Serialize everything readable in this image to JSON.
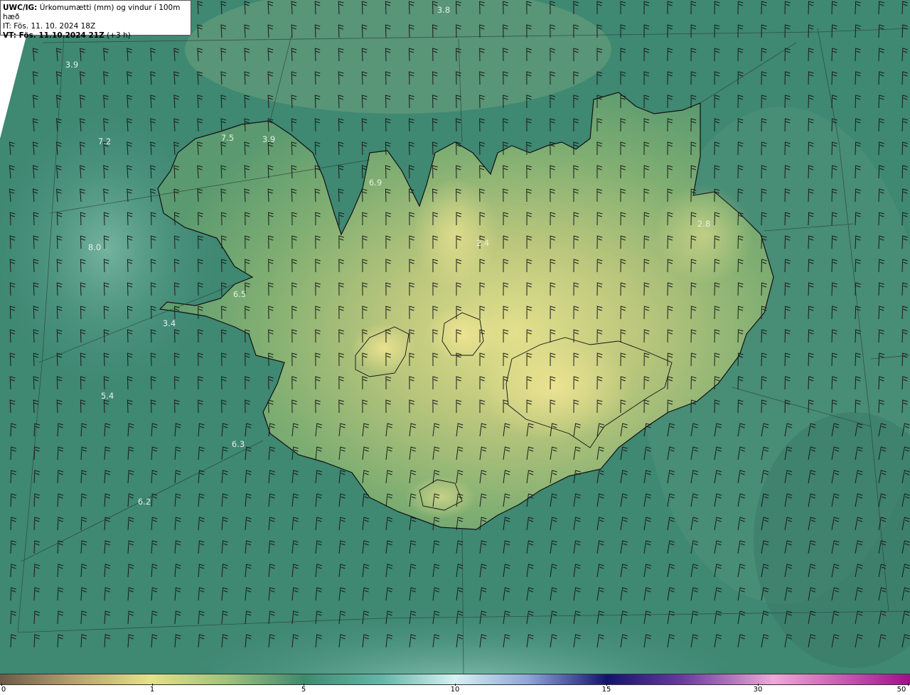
{
  "header": {
    "model": "UWC/IG:",
    "title": "Úrkomumætti (mm) og vindur í 100m hæð",
    "init_line": "IT: Fös. 11. 10. 2024 18Z",
    "valid_prefix": "VT: Fös. 11.10.2024 21Z",
    "valid_suffix": "(+3 h)"
  },
  "map_labels": [
    {
      "text": "3.8"
    },
    {
      "text": "3.9"
    },
    {
      "text": "7.2"
    },
    {
      "text": "7.5"
    },
    {
      "text": "3.9"
    },
    {
      "text": "6.9"
    },
    {
      "text": "2.8"
    },
    {
      "text": "2.4"
    },
    {
      "text": "8.0"
    },
    {
      "text": "6.5"
    },
    {
      "text": "3.4"
    },
    {
      "text": "5.4"
    },
    {
      "text": "6.3"
    },
    {
      "text": "6.2"
    }
  ],
  "colorbar": {
    "ticks": [
      "0",
      "1",
      "5",
      "10",
      "15",
      "30",
      "50"
    ],
    "colors": {
      "brown": "#6b5a46",
      "tan": "#c8b27c",
      "yellow": "#e6e08a",
      "green": "#3f8a6e",
      "teal": "#64b6a8",
      "ice": "#d6f2f2",
      "blue": "#2a2f9c",
      "navy": "#14146a",
      "purple": "#9a5aa8",
      "pink": "#f0a8d8",
      "magenta": "#a0108a"
    }
  },
  "map_colors": {
    "sea": "#3f8872",
    "land_low": "#5d9a6e",
    "land_high": "#d8dc86",
    "coast": "#111111"
  }
}
